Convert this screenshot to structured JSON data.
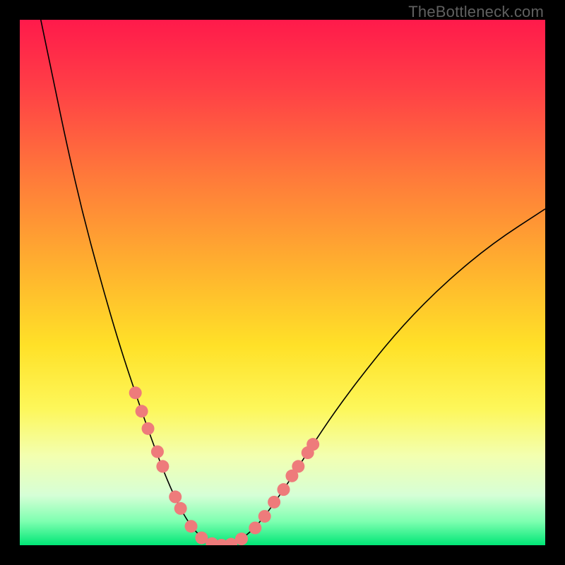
{
  "watermark": {
    "text": "TheBottleneck.com"
  },
  "chart_data": {
    "type": "line",
    "title": "",
    "xlabel": "",
    "ylabel": "",
    "xlim": [
      0,
      100
    ],
    "ylim": [
      0,
      100
    ],
    "gradient_stops": [
      {
        "offset": 0.0,
        "color": "#ff1a4b"
      },
      {
        "offset": 0.13,
        "color": "#ff3f46"
      },
      {
        "offset": 0.3,
        "color": "#ff7a3a"
      },
      {
        "offset": 0.48,
        "color": "#ffb42e"
      },
      {
        "offset": 0.62,
        "color": "#ffe128"
      },
      {
        "offset": 0.74,
        "color": "#fdf75a"
      },
      {
        "offset": 0.83,
        "color": "#f3ffb0"
      },
      {
        "offset": 0.905,
        "color": "#d6ffd6"
      },
      {
        "offset": 0.955,
        "color": "#7dffb0"
      },
      {
        "offset": 1.0,
        "color": "#00e676"
      }
    ],
    "series": [
      {
        "name": "bottleneck-curve",
        "color": "#000000",
        "width": 1.6,
        "points": [
          {
            "x": 4.0,
            "y": 100.0
          },
          {
            "x": 6.5,
            "y": 88.0
          },
          {
            "x": 9.0,
            "y": 76.0
          },
          {
            "x": 12.0,
            "y": 63.0
          },
          {
            "x": 15.5,
            "y": 50.0
          },
          {
            "x": 19.0,
            "y": 38.0
          },
          {
            "x": 22.5,
            "y": 27.5
          },
          {
            "x": 25.5,
            "y": 19.0
          },
          {
            "x": 28.0,
            "y": 12.5
          },
          {
            "x": 30.5,
            "y": 7.0
          },
          {
            "x": 33.0,
            "y": 3.0
          },
          {
            "x": 35.5,
            "y": 0.8
          },
          {
            "x": 38.0,
            "y": 0.0
          },
          {
            "x": 41.0,
            "y": 0.5
          },
          {
            "x": 44.0,
            "y": 2.5
          },
          {
            "x": 47.0,
            "y": 6.0
          },
          {
            "x": 50.5,
            "y": 11.0
          },
          {
            "x": 55.0,
            "y": 18.0
          },
          {
            "x": 60.0,
            "y": 25.5
          },
          {
            "x": 66.0,
            "y": 33.5
          },
          {
            "x": 73.0,
            "y": 42.0
          },
          {
            "x": 81.0,
            "y": 50.0
          },
          {
            "x": 90.0,
            "y": 57.5
          },
          {
            "x": 100.0,
            "y": 64.0
          }
        ]
      },
      {
        "name": "highlight-dots",
        "color": "#ee7b7b",
        "radius_px": 9,
        "points": [
          {
            "x": 22.0,
            "y": 29.0
          },
          {
            "x": 23.2,
            "y": 25.5
          },
          {
            "x": 24.4,
            "y": 22.2
          },
          {
            "x": 26.2,
            "y": 17.8
          },
          {
            "x": 27.2,
            "y": 15.0
          },
          {
            "x": 29.6,
            "y": 9.2
          },
          {
            "x": 30.6,
            "y": 7.0
          },
          {
            "x": 32.6,
            "y": 3.6
          },
          {
            "x": 34.6,
            "y": 1.4
          },
          {
            "x": 36.6,
            "y": 0.3
          },
          {
            "x": 38.4,
            "y": 0.0
          },
          {
            "x": 40.2,
            "y": 0.2
          },
          {
            "x": 42.2,
            "y": 1.2
          },
          {
            "x": 44.8,
            "y": 3.3
          },
          {
            "x": 46.6,
            "y": 5.5
          },
          {
            "x": 48.4,
            "y": 8.2
          },
          {
            "x": 50.2,
            "y": 10.6
          },
          {
            "x": 51.8,
            "y": 13.2
          },
          {
            "x": 53.0,
            "y": 15.0
          },
          {
            "x": 54.8,
            "y": 17.6
          },
          {
            "x": 55.8,
            "y": 19.2
          }
        ]
      }
    ]
  }
}
